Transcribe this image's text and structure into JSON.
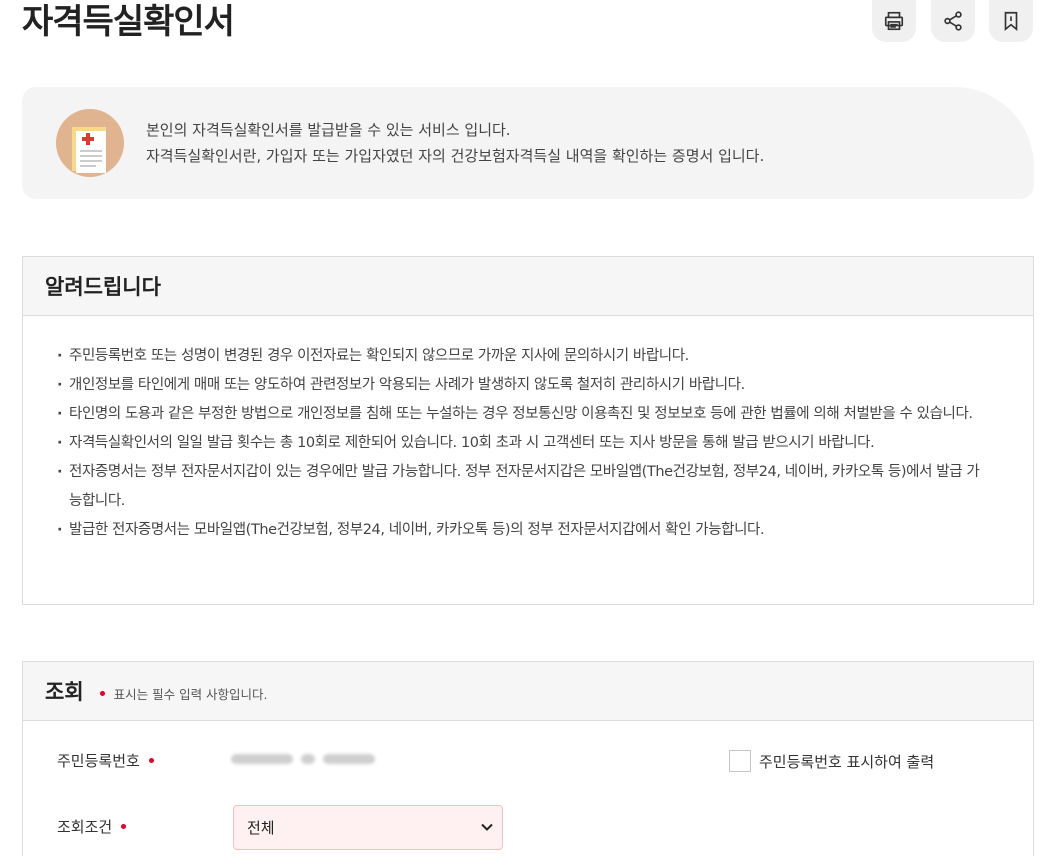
{
  "page": {
    "title": "자격득실확인서"
  },
  "toolbar": [
    {
      "icon": "print-icon"
    },
    {
      "icon": "share-icon"
    },
    {
      "icon": "bookmark-icon"
    }
  ],
  "intro": {
    "icon": "certificate-icon",
    "line1": "본인의 자격득실확인서를 발급받을 수 있는 서비스 입니다.",
    "line2": "자격득실확인서란, 가입자 또는 가입자였던 자의 건강보험자격득실 내역을 확인하는 증명서 입니다."
  },
  "notice": {
    "title": "알려드립니다",
    "items": [
      "주민등록번호 또는 성명이 변경된 경우 이전자료는 확인되지 않으므로 가까운 지사에 문의하시기 바랍니다.",
      "개인정보를 타인에게 매매 또는 양도하여 관련정보가 악용되는 사례가 발생하지 않도록 철저히 관리하시기 바랍니다.",
      "타인명의 도용과 같은 부정한 방법으로 개인정보를 침해 또는 누설하는 경우 정보통신망 이용촉진 및 정보보호 등에 관한 법률에 의해 처벌받을 수 있습니다.",
      "자격득실확인서의 일일 발급 횟수는 총 10회로 제한되어 있습니다. 10회 초과 시 고객센터 또는 지사 방문을 통해 발급 받으시기 바랍니다.",
      "전자증명서는 정부 전자문서지갑이 있는 경우에만 발급 가능합니다. 정부 전자문서지갑은 모바일앱(The건강보험, 정부24, 네이버, 카카오톡 등)에서 발급 가능합니다.",
      "발급한 전자증명서는 모바일앱(The건강보험, 정부24, 네이버, 카카오톡 등)의 정부 전자문서지갑에서 확인 가능합니다."
    ]
  },
  "query": {
    "title": "조회",
    "required_note": "표시는 필수 입력 사항입니다.",
    "rrn_label": "주민등록번호",
    "show_rrn_label": "주민등록번호 표시하여 출력",
    "condition_label": "조회조건",
    "condition_value": "전체"
  },
  "colors": {
    "required": "#e4002b",
    "select_bg": "#fff1f1"
  }
}
